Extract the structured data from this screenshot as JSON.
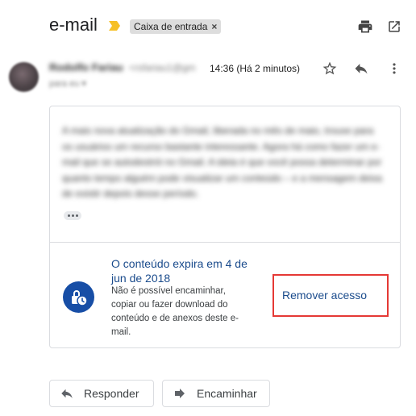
{
  "header": {
    "subject": "e-mail",
    "label_chip": "Caixa de entrada",
    "label_remove": "×"
  },
  "sender": {
    "name": "Rodolfo Fariau",
    "email": "<rsfariau1@gm",
    "to_line": "para eu ▾",
    "timestamp": "14:36 (Há 2 minutos)"
  },
  "message": {
    "body_blurred": "A mais nova atualização do Gmail, liberada no mês de maio, trouxe para os usuários um recurso bastante interessante. Agora há como fazer um e-mail que se autodestrói no Gmail. A ideia é que você possa determinar por quanto tempo alguém pode visualizar um conteúdo – e a mensagem deixa de existir depois desse período."
  },
  "confidential": {
    "title": "O conteúdo expira em 4 de jun de 2018",
    "description": "Não é possível encaminhar, copiar ou fazer download do conteúdo e de anexos deste e-mail.",
    "remove_access": "Remover acesso"
  },
  "actions": {
    "reply": "Responder",
    "forward": "Encaminhar"
  },
  "colors": {
    "accent": "#174ea6",
    "link_text": "#1a4b8c",
    "highlight_box": "#e53935",
    "importance_marker": "#f6c026"
  },
  "icons": [
    "importance-marker-icon",
    "print-icon",
    "open-in-new-window-icon",
    "star-icon",
    "reply-icon",
    "more-vert-icon",
    "ellipsis-icon",
    "lock-clock-icon",
    "reply-arrow-icon",
    "forward-arrow-icon"
  ]
}
